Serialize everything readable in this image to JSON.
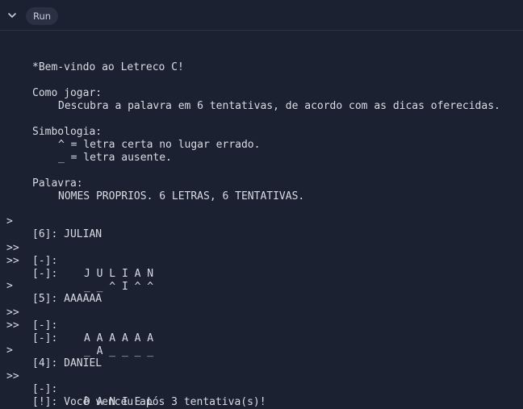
{
  "toolbar": {
    "collapse_icon": "chevron-down-icon",
    "run_label": "Run"
  },
  "console": {
    "welcome": "*Bem-vindo ao Letreco C!",
    "how_to_title": "Como jogar:",
    "how_to_text": "Descubra a palavra em 6 tentativas, de acordo com as dicas oferecidas.",
    "symbols_title": "Simbologia:",
    "symbol_caret": "^ = letra certa no lugar errado.",
    "symbol_underscore": "_ = letra ausente.",
    "word_title": "Palavra:",
    "word_info": "NOMES PROPRIOS. 6 LETRAS, 6 TENTATIVAS.",
    "prompt_single": ">",
    "prompt_double": ">>",
    "attempts": [
      {
        "input": "[6]: JULIAN",
        "label_letters": "[-]:",
        "letters": "J U L I A N",
        "label_hints": "[-]:",
        "hints": "_ _ ^ I ^ ^"
      },
      {
        "input": "[5]: AAAAAA",
        "label_letters": "[-]:",
        "letters": "A A A A A A",
        "label_hints": "[-]:",
        "hints": "_ A _ _ _ _"
      },
      {
        "input": "[4]: DANIEL",
        "label_letters": "[-]:",
        "letters": "D A N I E L"
      }
    ],
    "result": "[!]: Você venceu após 3 tentativa(s)!"
  },
  "colors": {
    "background": "#1b2130",
    "text": "#d8dce4",
    "button_bg": "#2a3142"
  }
}
